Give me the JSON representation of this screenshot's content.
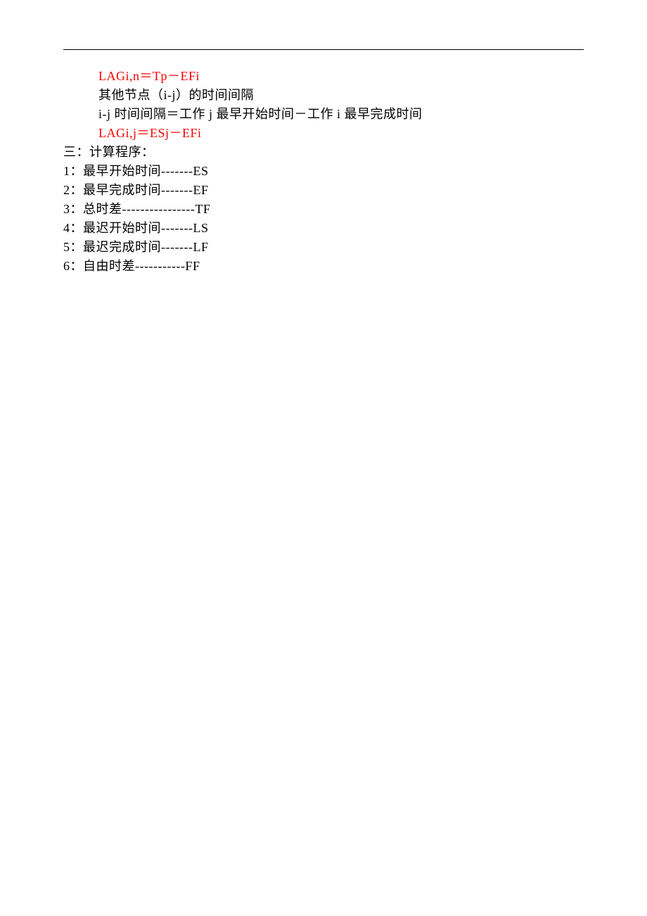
{
  "lines": [
    {
      "cls": "indent1 red",
      "text": "LAGi,n＝Tp－EFi"
    },
    {
      "cls": "indent1",
      "text": "其他节点（i-j）的时间间隔"
    },
    {
      "cls": "indent1",
      "text": "i-j 时间间隔＝工作 j 最早开始时间－工作 i 最早完成时间"
    },
    {
      "cls": "indent1 red",
      "text": "LAGi,j＝ESj－EFi"
    },
    {
      "cls": "indent0",
      "text": "三：计算程序："
    },
    {
      "cls": "indent0",
      "text": "1：最早开始时间-------ES"
    },
    {
      "cls": "indent0",
      "text": "2：最早完成时间-------EF"
    },
    {
      "cls": "indent0",
      "text": "3：总时差----------------TF"
    },
    {
      "cls": "indent0",
      "text": "4：最迟开始时间-------LS"
    },
    {
      "cls": "indent0",
      "text": "5：最迟完成时间-------LF"
    },
    {
      "cls": "indent0",
      "text": "6：自由时差-----------FF"
    }
  ]
}
